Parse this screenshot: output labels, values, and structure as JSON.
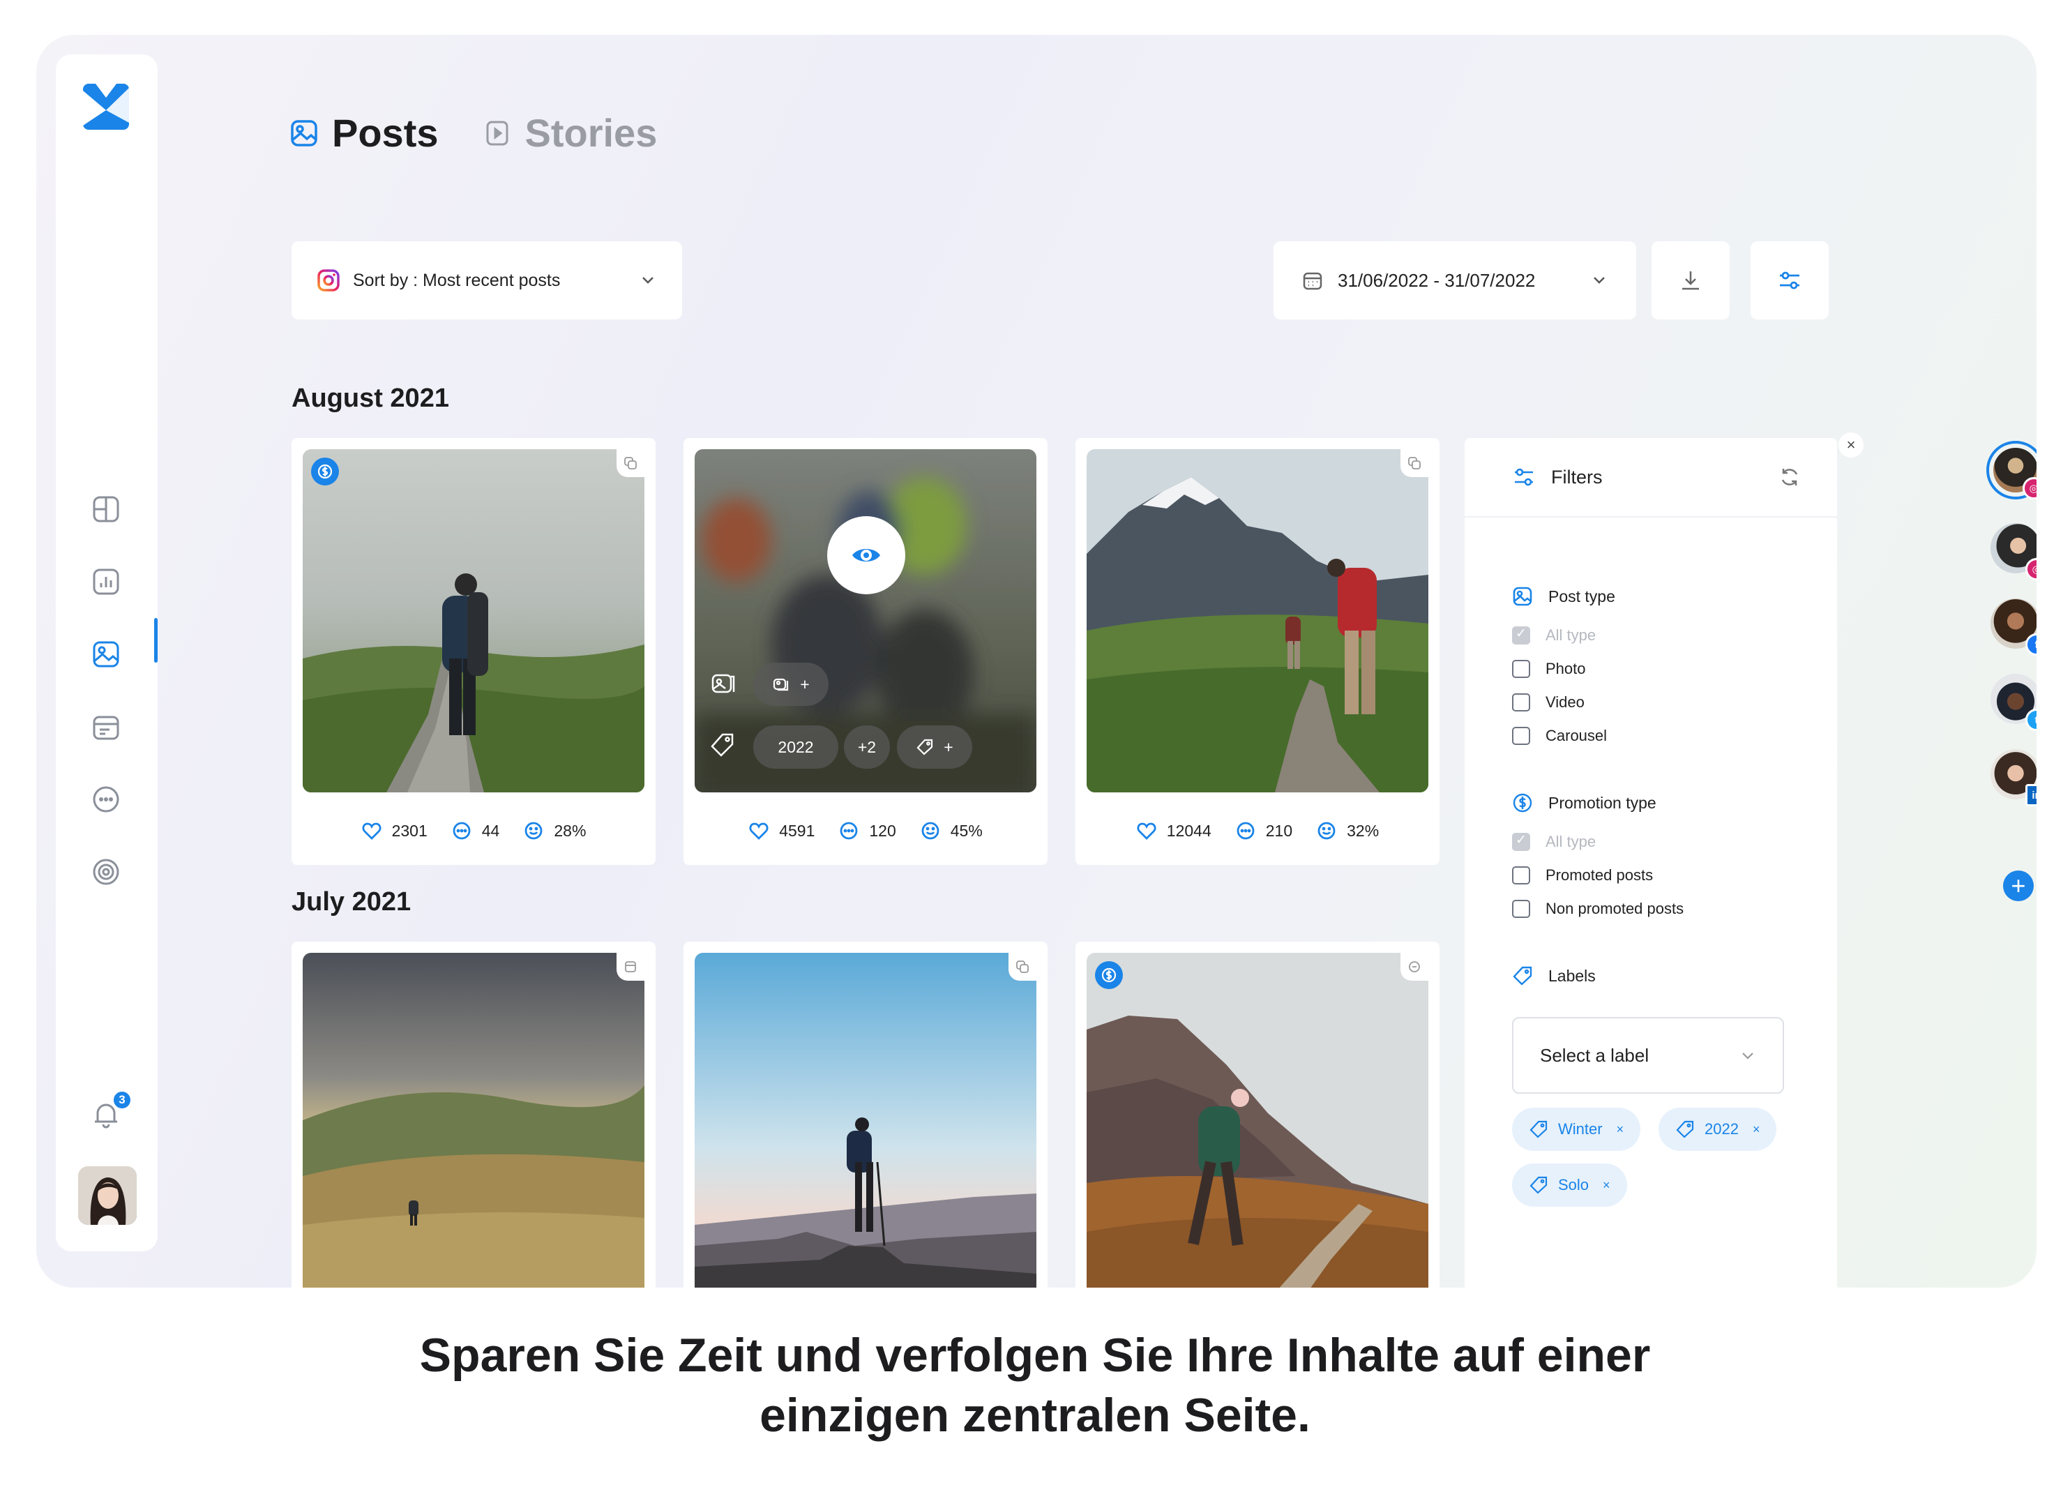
{
  "tabs": [
    {
      "label": "Posts",
      "active": true
    },
    {
      "label": "Stories",
      "active": false
    }
  ],
  "toolbar": {
    "sort_label": "Sort by : Most recent posts",
    "date_range": "31/06/2022 - 31/07/2022"
  },
  "sections": [
    {
      "title": "August 2021"
    },
    {
      "title": "July 2021"
    }
  ],
  "august_posts": [
    {
      "likes": "2301",
      "comments": "44",
      "engagement": "28%"
    },
    {
      "likes": "4591",
      "comments": "120",
      "engagement": "45%"
    },
    {
      "likes": "12044",
      "comments": "210",
      "engagement": "32%"
    }
  ],
  "overlay": {
    "label_year": "2022",
    "more_count": "+2",
    "add": "+"
  },
  "filters": {
    "title": "Filters",
    "post_type": {
      "title": "Post type",
      "options": [
        "All type",
        "Photo",
        "Video",
        "Carousel"
      ]
    },
    "promotion_type": {
      "title": "Promotion type",
      "options": [
        "All type",
        "Promoted posts",
        "Non promoted posts"
      ]
    },
    "labels": {
      "title": "Labels",
      "placeholder": "Select a label",
      "chips": [
        "Winter",
        "2022",
        "Solo"
      ]
    }
  },
  "notifications": {
    "count": "3"
  },
  "accounts": [
    {
      "network": "instagram",
      "color": "#d6246f"
    },
    {
      "network": "instagram",
      "color": "#d6246f"
    },
    {
      "network": "facebook",
      "color": "#1877f2"
    },
    {
      "network": "twitter",
      "color": "#1da1f2"
    },
    {
      "network": "linkedin",
      "color": "#0a66c2"
    }
  ],
  "caption": {
    "line1": "Sparen Sie Zeit und verfolgen Sie Ihre Inhalte auf einer",
    "line2": "einzigen zentralen Seite."
  },
  "colors": {
    "accent": "#1a84e8"
  }
}
